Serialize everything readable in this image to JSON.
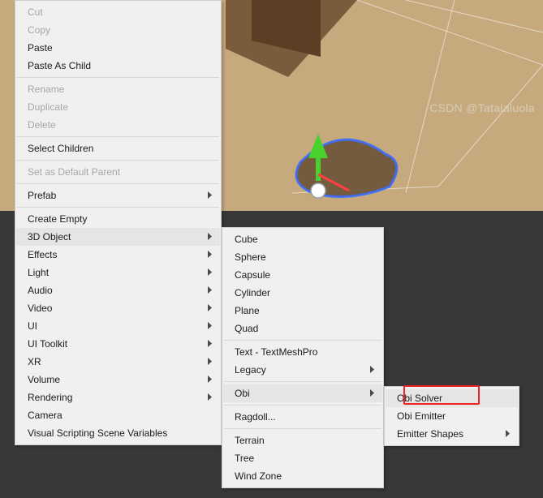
{
  "watermark": "CSDN @Tatalaluola",
  "menu1": {
    "items": [
      {
        "label": "Cut",
        "disabled": true
      },
      {
        "label": "Copy",
        "disabled": true
      },
      {
        "label": "Paste"
      },
      {
        "label": "Paste As Child"
      },
      {
        "sep": true
      },
      {
        "label": "Rename",
        "disabled": true
      },
      {
        "label": "Duplicate",
        "disabled": true
      },
      {
        "label": "Delete",
        "disabled": true
      },
      {
        "sep": true
      },
      {
        "label": "Select Children"
      },
      {
        "sep": true
      },
      {
        "label": "Set as Default Parent",
        "disabled": true
      },
      {
        "sep": true
      },
      {
        "label": "Prefab",
        "sub": true
      },
      {
        "sep": true
      },
      {
        "label": "Create Empty"
      },
      {
        "label": "3D Object",
        "sub": true,
        "hl": true
      },
      {
        "label": "Effects",
        "sub": true
      },
      {
        "label": "Light",
        "sub": true
      },
      {
        "label": "Audio",
        "sub": true
      },
      {
        "label": "Video",
        "sub": true
      },
      {
        "label": "UI",
        "sub": true
      },
      {
        "label": "UI Toolkit",
        "sub": true
      },
      {
        "label": "XR",
        "sub": true
      },
      {
        "label": "Volume",
        "sub": true
      },
      {
        "label": "Rendering",
        "sub": true
      },
      {
        "label": "Camera"
      },
      {
        "label": "Visual Scripting Scene Variables"
      }
    ]
  },
  "menu2": {
    "items": [
      {
        "label": "Cube"
      },
      {
        "label": "Sphere"
      },
      {
        "label": "Capsule"
      },
      {
        "label": "Cylinder"
      },
      {
        "label": "Plane"
      },
      {
        "label": "Quad"
      },
      {
        "sep": true
      },
      {
        "label": "Text - TextMeshPro"
      },
      {
        "label": "Legacy",
        "sub": true
      },
      {
        "sep": true
      },
      {
        "label": "Obi",
        "sub": true,
        "hl": true
      },
      {
        "sep": true
      },
      {
        "label": "Ragdoll..."
      },
      {
        "sep": true
      },
      {
        "label": "Terrain"
      },
      {
        "label": "Tree"
      },
      {
        "label": "Wind Zone"
      }
    ]
  },
  "menu3": {
    "items": [
      {
        "label": "Obi Solver",
        "hl": true
      },
      {
        "label": "Obi Emitter"
      },
      {
        "label": "Emitter Shapes",
        "sub": true
      }
    ]
  }
}
